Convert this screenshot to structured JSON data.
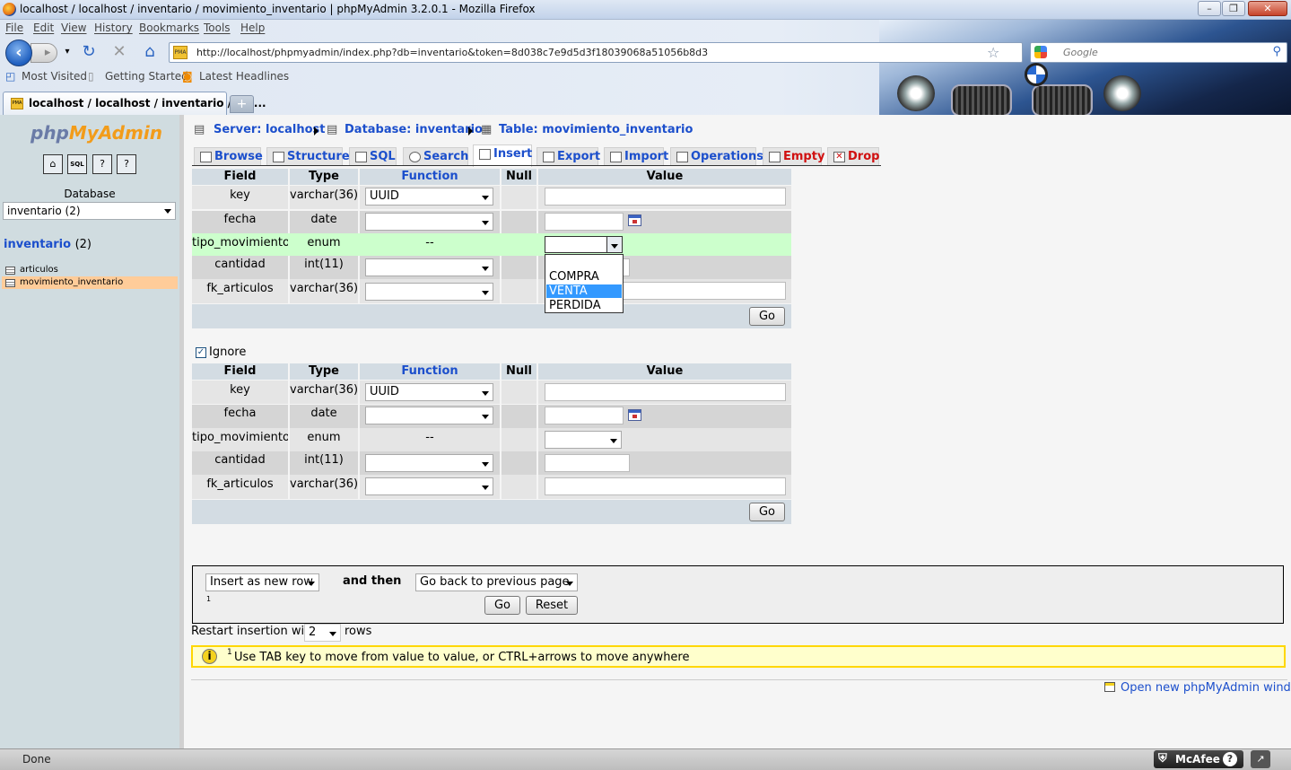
{
  "window": {
    "title": "localhost / localhost / inventario / movimiento_inventario | phpMyAdmin 3.2.0.1 - Mozilla Firefox"
  },
  "menu": [
    "File",
    "Edit",
    "View",
    "History",
    "Bookmarks",
    "Tools",
    "Help"
  ],
  "address": {
    "url": "http://localhost/phpmyadmin/index.php?db=inventario&token=8d038c7e9d5d3f18039068a51056b8d3"
  },
  "search": {
    "placeholder": "Google"
  },
  "bookmarks": [
    "Most Visited",
    "Getting Started",
    "Latest Headlines"
  ],
  "tab": {
    "label": "localhost / localhost / inventario / mo..."
  },
  "sidebar": {
    "logo_php": "php",
    "logo_my": "MyAdmin",
    "db_label": "Database",
    "db_selected": "inventario (2)",
    "db_name": "inventario",
    "db_count": "(2)",
    "tables": [
      "articulos",
      "movimiento_inventario"
    ]
  },
  "breadcrumb": {
    "server": "Server: localhost",
    "database": "Database: inventario",
    "table": "Table: movimiento_inventario"
  },
  "tabs": [
    "Browse",
    "Structure",
    "SQL",
    "Search",
    "Insert",
    "Export",
    "Import",
    "Operations",
    "Empty",
    "Drop"
  ],
  "headers": {
    "field": "Field",
    "type": "Type",
    "function": "Function",
    "null": "Null",
    "value": "Value"
  },
  "rows1": [
    {
      "field": "key",
      "type": "varchar(36)",
      "func": "UUID"
    },
    {
      "field": "fecha",
      "type": "date",
      "func": ""
    },
    {
      "field": "tipo_movimiento",
      "type": "enum",
      "func": "--"
    },
    {
      "field": "cantidad",
      "type": "int(11)",
      "func": ""
    },
    {
      "field": "fk_articulos",
      "type": "varchar(36)",
      "func": ""
    }
  ],
  "rows2": [
    {
      "field": "key",
      "type": "varchar(36)",
      "func": "UUID"
    },
    {
      "field": "fecha",
      "type": "date",
      "func": ""
    },
    {
      "field": "tipo_movimiento",
      "type": "enum",
      "func": "--"
    },
    {
      "field": "cantidad",
      "type": "int(11)",
      "func": ""
    },
    {
      "field": "fk_articulos",
      "type": "varchar(36)",
      "func": ""
    }
  ],
  "enum_options": [
    "COMPRA",
    "VENTA",
    "PERDIDA"
  ],
  "go_label": "Go",
  "ignore_label": "Ignore",
  "insert_options": {
    "mode": "Insert as new row",
    "and_then": "and then",
    "after": "Go back to previous page",
    "footnote": "1",
    "go": "Go",
    "reset": "Reset"
  },
  "restart": {
    "prefix": "Restart insertion with",
    "count": "2",
    "suffix": "rows"
  },
  "hint": {
    "sup": "1",
    "text": "Use TAB key to move from value to value, or CTRL+arrows to move anywhere"
  },
  "new_window": "Open new phpMyAdmin window",
  "status": {
    "text": "Done",
    "mcafee": "McAfee"
  }
}
